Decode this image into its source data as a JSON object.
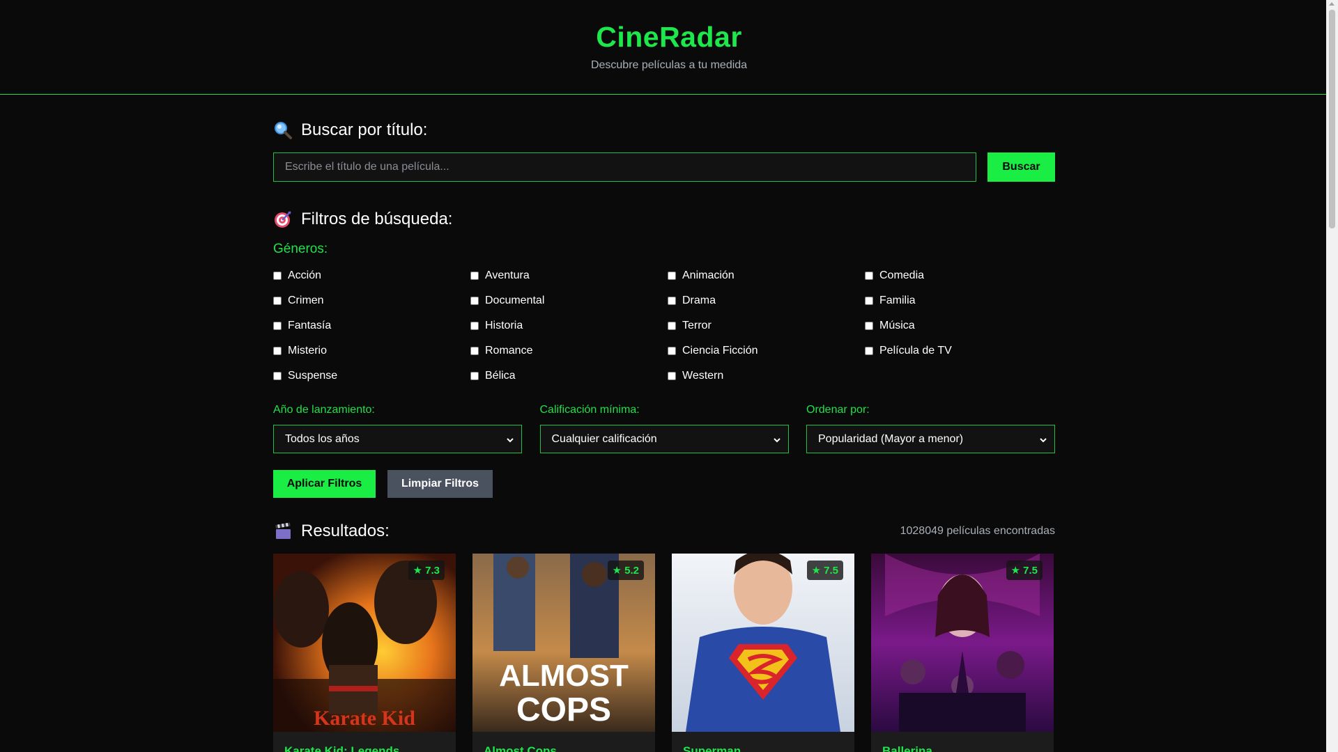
{
  "header": {
    "title": "CineRadar",
    "subtitle": "Descubre películas a tu medida"
  },
  "search": {
    "title": "Buscar por título:",
    "placeholder": "Escribe el título de una película...",
    "button_label": "Buscar"
  },
  "filters": {
    "title": "Filtros de búsqueda:",
    "genres_label": "Géneros:",
    "genres": [
      "Acción",
      "Aventura",
      "Animación",
      "Comedia",
      "Crimen",
      "Documental",
      "Drama",
      "Familia",
      "Fantasía",
      "Historia",
      "Terror",
      "Música",
      "Misterio",
      "Romance",
      "Ciencia Ficción",
      "Película de TV",
      "Suspense",
      "Bélica",
      "Western"
    ],
    "year": {
      "label": "Año de lanzamiento:",
      "value": "Todos los años"
    },
    "rating": {
      "label": "Calificación mínima:",
      "value": "Cualquier calificación"
    },
    "order": {
      "label": "Ordenar por:",
      "value": "Popularidad (Mayor a menor)"
    },
    "apply_label": "Aplicar Filtros",
    "clear_label": "Limpiar Filtros"
  },
  "results": {
    "title": "Resultados:",
    "count": "1028049 películas encontradas",
    "movies": [
      {
        "title": "Karate Kid: Legends",
        "rating": "★ 7.3",
        "poster_text": "Karate Kid"
      },
      {
        "title": "Almost Cops",
        "rating": "★ 5.2",
        "poster_text": "ALMOST COPS"
      },
      {
        "title": "Superman",
        "rating": "★ 7.5",
        "poster_text": ""
      },
      {
        "title": "Ballerina",
        "rating": "★ 7.5",
        "poster_text": ""
      }
    ]
  },
  "colors": {
    "accent": "#1de74a",
    "background": "#0a0a0a",
    "clear_button": "#4a5260"
  }
}
